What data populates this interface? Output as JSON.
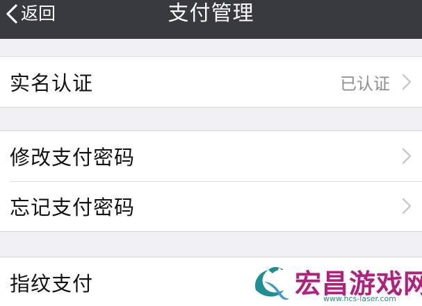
{
  "navbar": {
    "back_label": "返回",
    "title": "支付管理",
    "background": "#393a3f"
  },
  "groups": [
    {
      "rows": [
        {
          "label": "实名认证",
          "value": "已认证",
          "chevron": "chevron-right-icon"
        }
      ]
    },
    {
      "rows": [
        {
          "label": "修改支付密码",
          "chevron": "chevron-right-icon"
        },
        {
          "label": "忘记支付密码",
          "chevron": "chevron-right-icon"
        }
      ]
    },
    {
      "rows": [
        {
          "label": "指纹支付"
        }
      ]
    }
  ],
  "watermark": {
    "name": "宏昌游戏网",
    "url": "www.hcs-laser.com",
    "name_color": "#b1207e",
    "logo_icon": "dragon-logo-icon"
  }
}
